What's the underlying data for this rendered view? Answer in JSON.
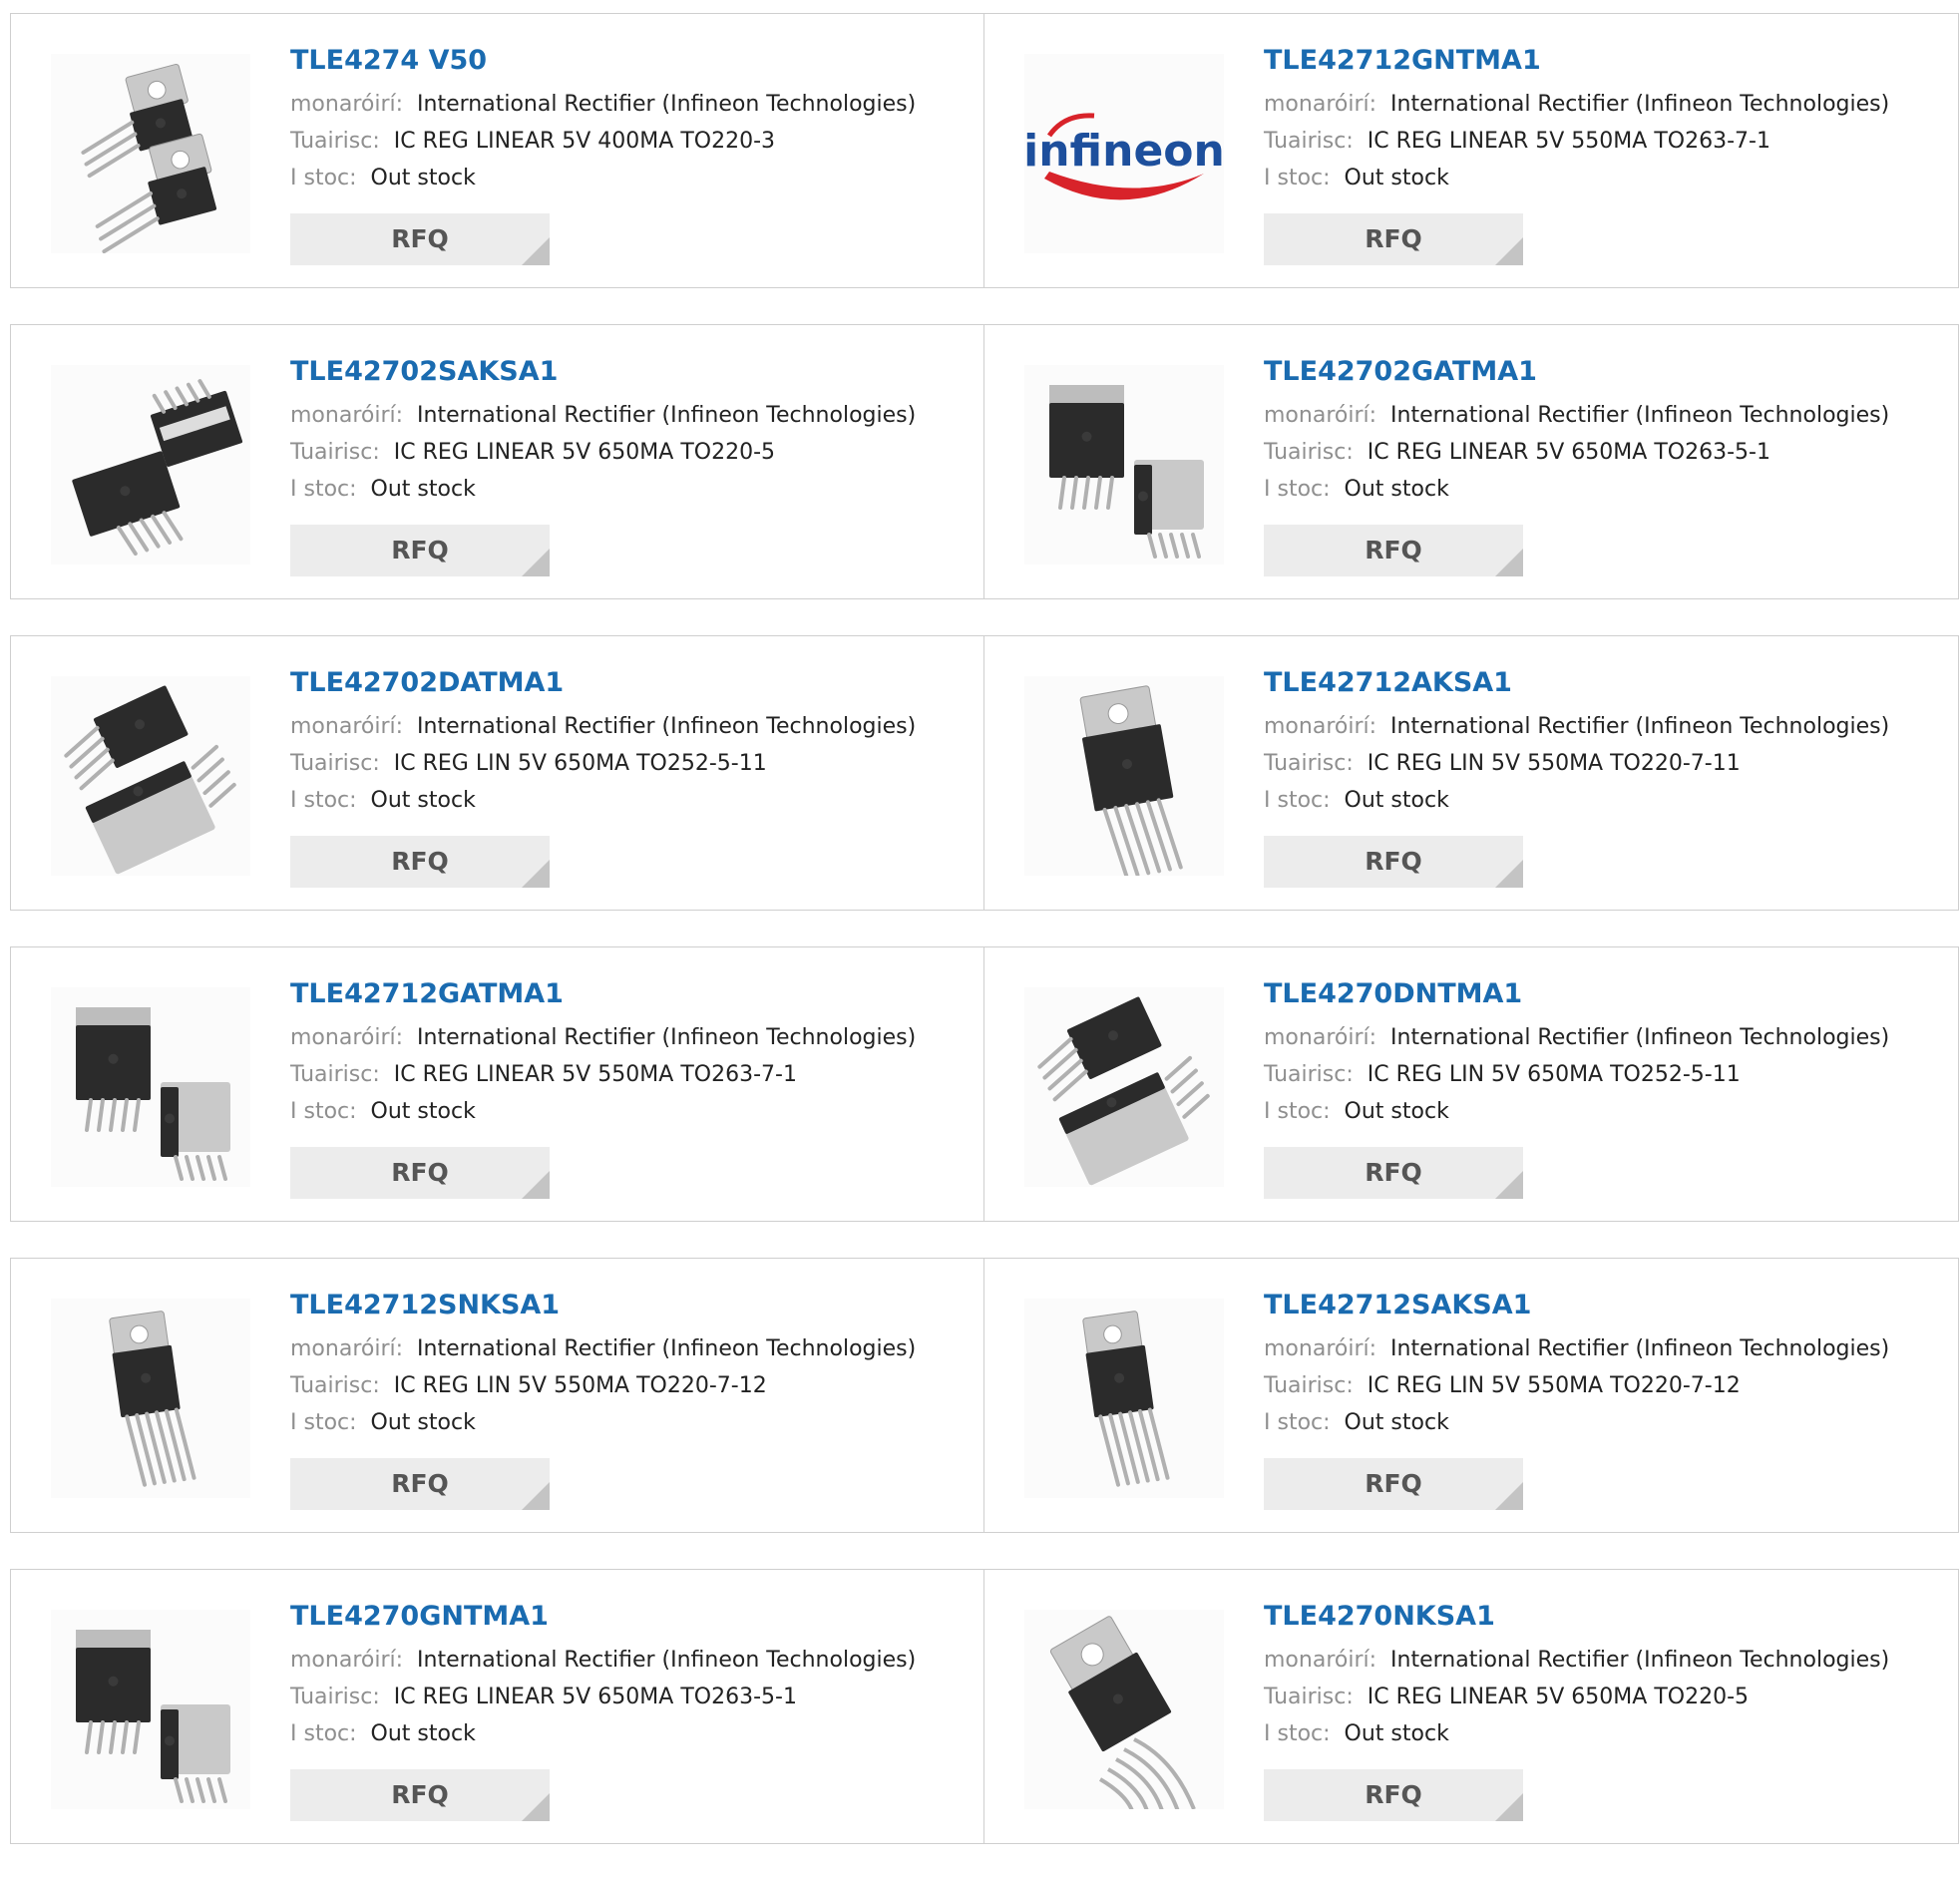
{
  "labels": {
    "manufacturer": "monaróirí:",
    "description": "Tuairisc:",
    "stock": "I stoc:",
    "rfq": "RFQ"
  },
  "products": [
    {
      "part": "TLE4274 V50",
      "manufacturer": "International Rectifier (Infineon Technologies)",
      "description": "IC REG LINEAR 5V 400MA TO220-3",
      "stock": "Out stock",
      "image": "to220-3-pair"
    },
    {
      "part": "TLE42712GNTMA1",
      "manufacturer": "International Rectifier (Infineon Technologies)",
      "description": "IC REG LINEAR 5V 550MA TO263-7-1",
      "stock": "Out stock",
      "image": "infineon-logo"
    },
    {
      "part": "TLE42702SAKSA1",
      "manufacturer": "International Rectifier (Infineon Technologies)",
      "description": "IC REG LINEAR 5V 650MA TO220-5",
      "stock": "Out stock",
      "image": "to220-5-pair"
    },
    {
      "part": "TLE42702GATMA1",
      "manufacturer": "International Rectifier (Infineon Technologies)",
      "description": "IC REG LINEAR 5V 650MA TO263-5-1",
      "stock": "Out stock",
      "image": "to263-pair"
    },
    {
      "part": "TLE42702DATMA1",
      "manufacturer": "International Rectifier (Infineon Technologies)",
      "description": "IC REG LIN 5V 650MA TO252-5-11",
      "stock": "Out stock",
      "image": "to252-pair"
    },
    {
      "part": "TLE42712AKSA1",
      "manufacturer": "International Rectifier (Infineon Technologies)",
      "description": "IC REG LIN 5V 550MA TO220-7-11",
      "stock": "Out stock",
      "image": "to220-7-staggered"
    },
    {
      "part": "TLE42712GATMA1",
      "manufacturer": "International Rectifier (Infineon Technologies)",
      "description": "IC REG LINEAR 5V 550MA TO263-7-1",
      "stock": "Out stock",
      "image": "to263-pair"
    },
    {
      "part": "TLE4270DNTMA1",
      "manufacturer": "International Rectifier (Infineon Technologies)",
      "description": "IC REG LIN 5V 650MA TO252-5-11",
      "stock": "Out stock",
      "image": "to252-pair"
    },
    {
      "part": "TLE42712SNKSA1",
      "manufacturer": "International Rectifier (Infineon Technologies)",
      "description": "IC REG LIN 5V 550MA TO220-7-12",
      "stock": "Out stock",
      "image": "to220-7-single"
    },
    {
      "part": "TLE42712SAKSA1",
      "manufacturer": "International Rectifier (Infineon Technologies)",
      "description": "IC REG LIN 5V 550MA TO220-7-12",
      "stock": "Out stock",
      "image": "to220-7-single"
    },
    {
      "part": "TLE4270GNTMA1",
      "manufacturer": "International Rectifier (Infineon Technologies)",
      "description": "IC REG LINEAR 5V 650MA TO263-5-1",
      "stock": "Out stock",
      "image": "to263-pair"
    },
    {
      "part": "TLE4270NKSA1",
      "manufacturer": "International Rectifier (Infineon Technologies)",
      "description": "IC REG LINEAR 5V 650MA TO220-5",
      "stock": "Out stock",
      "image": "to220-5-bent"
    }
  ],
  "logo_text": "infineon",
  "colors": {
    "link": "#1a6bb0",
    "label": "#8f8f8f",
    "button": "#ececec",
    "logo": "#1d4f9c",
    "logo_swoosh": "#d8232a"
  }
}
